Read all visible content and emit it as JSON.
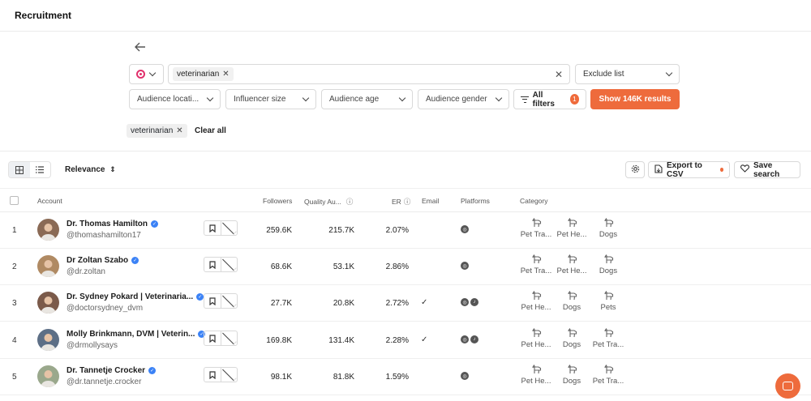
{
  "app": {
    "title": "Recruitment"
  },
  "search": {
    "keyword": "veterinarian",
    "exclude_label": "Exclude list",
    "filters": [
      "Audience locati...",
      "Influencer size",
      "Audience age",
      "Audience gender"
    ],
    "all_filters_label": "All filters",
    "all_filters_count": "1",
    "show_results_label": "Show 146K results",
    "applied_chip": "veterinarian",
    "clear_all_label": "Clear all"
  },
  "toolbar": {
    "sort_label": "Relevance",
    "export_label": "Export to CSV",
    "save_label": "Save search"
  },
  "table": {
    "headers": {
      "account": "Account",
      "followers": "Followers",
      "quality": "Quality Au...",
      "er": "ER",
      "email": "Email",
      "platforms": "Platforms",
      "category": "Category"
    },
    "rows": [
      {
        "index": "1",
        "name": "Dr. Thomas Hamilton",
        "handle": "@thomashamilton17",
        "followers": "259.6K",
        "quality": "215.7K",
        "er": "2.07%",
        "email": "",
        "platforms": [
          "instagram"
        ],
        "categories": [
          "Pet Tra...",
          "Pet He...",
          "Dogs"
        ],
        "avatar_color": "#8a6a55"
      },
      {
        "index": "2",
        "name": "Dr Zoltan Szabo",
        "handle": "@dr.zoltan",
        "followers": "68.6K",
        "quality": "53.1K",
        "er": "2.86%",
        "email": "",
        "platforms": [
          "instagram"
        ],
        "categories": [
          "Pet Tra...",
          "Pet He...",
          "Dogs"
        ],
        "avatar_color": "#b08a63"
      },
      {
        "index": "3",
        "name": "Dr. Sydney Pokard | Veterinaria...",
        "handle": "@doctorsydney_dvm",
        "followers": "27.7K",
        "quality": "20.8K",
        "er": "2.72%",
        "email": "✓",
        "platforms": [
          "instagram",
          "tiktok"
        ],
        "categories": [
          "Pet He...",
          "Dogs",
          "Pets"
        ],
        "avatar_color": "#7b5a4a"
      },
      {
        "index": "4",
        "name": "Molly Brinkmann, DVM | Veterin...",
        "handle": "@drmollysays",
        "followers": "169.8K",
        "quality": "131.4K",
        "er": "2.28%",
        "email": "✓",
        "platforms": [
          "instagram",
          "tiktok"
        ],
        "categories": [
          "Pet He...",
          "Dogs",
          "Pet Tra..."
        ],
        "avatar_color": "#5d6f86"
      },
      {
        "index": "5",
        "name": "Dr. Tannetje Crocker",
        "handle": "@dr.tannetje.crocker",
        "followers": "98.1K",
        "quality": "81.8K",
        "er": "1.59%",
        "email": "",
        "platforms": [
          "instagram"
        ],
        "categories": [
          "Pet He...",
          "Dogs",
          "Pet Tra..."
        ],
        "avatar_color": "#9aa88c"
      }
    ]
  },
  "colors": {
    "accent": "#ee6b3c",
    "verified": "#3b82f6"
  },
  "icons": [
    "back-arrow-icon",
    "instagram-icon",
    "chevron-down-icon",
    "close-icon",
    "filter-icon",
    "grid-view-icon",
    "list-view-icon",
    "sort-icon",
    "gear-icon",
    "export-icon",
    "heart-icon",
    "bookmark-icon",
    "verified-icon",
    "check-icon",
    "tiktok-icon",
    "dog-icon",
    "chat-icon"
  ]
}
